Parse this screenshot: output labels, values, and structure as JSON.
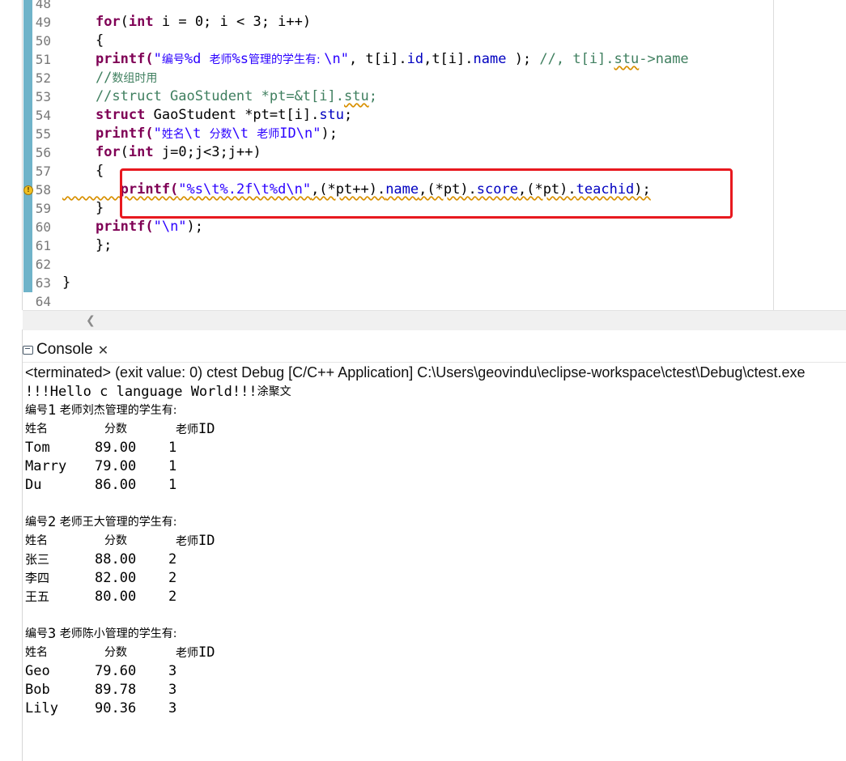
{
  "editor": {
    "lines": [
      {
        "num": "48",
        "segs": []
      },
      {
        "num": "49",
        "segs": [
          {
            "t": "    "
          },
          {
            "t": "for",
            "c": "kw"
          },
          {
            "t": "("
          },
          {
            "t": "int",
            "c": "kw"
          },
          {
            "t": " i = 0; i < 3; i++)"
          }
        ]
      },
      {
        "num": "50",
        "segs": [
          {
            "t": "    {"
          }
        ]
      },
      {
        "num": "51",
        "segs": [
          {
            "t": "    printf(",
            "c": "kw"
          },
          {
            "t": "\"",
            "c": "str"
          },
          {
            "t": "编号",
            "c": "str cjk"
          },
          {
            "t": "%d ",
            "c": "str"
          },
          {
            "t": "老师",
            "c": "str cjk"
          },
          {
            "t": "%s",
            "c": "str"
          },
          {
            "t": "管理的学生有: ",
            "c": "str cjk"
          },
          {
            "t": "\\n\"",
            "c": "str"
          },
          {
            "t": ", t[i]."
          },
          {
            "t": "id",
            "c": "fld"
          },
          {
            "t": ",t[i]."
          },
          {
            "t": "name",
            "c": "fld"
          },
          {
            "t": " ); "
          },
          {
            "t": "//, t[i].",
            "c": "cmt"
          },
          {
            "t": "stu",
            "c": "cmt sq"
          },
          {
            "t": "->name",
            "c": "cmt"
          }
        ]
      },
      {
        "num": "52",
        "segs": [
          {
            "t": "    //",
            "c": "cmt"
          },
          {
            "t": "数组时用",
            "c": "cmt cjk"
          }
        ]
      },
      {
        "num": "53",
        "segs": [
          {
            "t": "    //struct GaoStudent *pt=&t[i].",
            "c": "cmt"
          },
          {
            "t": "stu",
            "c": "cmt sq"
          },
          {
            "t": ";",
            "c": "cmt"
          }
        ]
      },
      {
        "num": "54",
        "segs": [
          {
            "t": "    "
          },
          {
            "t": "struct",
            "c": "kw"
          },
          {
            "t": " GaoStudent *pt=t[i]."
          },
          {
            "t": "stu",
            "c": "fld"
          },
          {
            "t": ";"
          }
        ]
      },
      {
        "num": "55",
        "segs": [
          {
            "t": "    printf(",
            "c": "kw"
          },
          {
            "t": "\"",
            "c": "str"
          },
          {
            "t": "姓名",
            "c": "str cjk"
          },
          {
            "t": "\\t ",
            "c": "str"
          },
          {
            "t": "分数",
            "c": "str cjk"
          },
          {
            "t": "\\t ",
            "c": "str"
          },
          {
            "t": "老师",
            "c": "str cjk"
          },
          {
            "t": "ID\\n\"",
            "c": "str"
          },
          {
            "t": ");"
          }
        ]
      },
      {
        "num": "56",
        "segs": [
          {
            "t": "    "
          },
          {
            "t": "for",
            "c": "kw"
          },
          {
            "t": "("
          },
          {
            "t": "int",
            "c": "kw"
          },
          {
            "t": " j=0;j<3;j++)"
          }
        ]
      },
      {
        "num": "57",
        "segs": [
          {
            "t": "    {"
          }
        ]
      },
      {
        "num": "58",
        "warn": true,
        "segs": [
          {
            "t": "       printf(",
            "c": "kw sq"
          },
          {
            "t": "\"%s\\t%.2f\\t%d\\n\"",
            "c": "str sq"
          },
          {
            "t": ",(*pt++).",
            "c": "sq"
          },
          {
            "t": "name",
            "c": "fld sq"
          },
          {
            "t": ",(*pt).",
            "c": "sq"
          },
          {
            "t": "score",
            "c": "fld sq"
          },
          {
            "t": ",(*pt).",
            "c": "sq"
          },
          {
            "t": "teachid",
            "c": "fld sq"
          },
          {
            "t": ");",
            "c": "sq"
          }
        ]
      },
      {
        "num": "59",
        "segs": [
          {
            "t": "    }"
          }
        ]
      },
      {
        "num": "60",
        "segs": [
          {
            "t": "    printf(",
            "c": "kw"
          },
          {
            "t": "\"\\n\"",
            "c": "str"
          },
          {
            "t": ");"
          }
        ]
      },
      {
        "num": "61",
        "segs": [
          {
            "t": "    };"
          }
        ]
      },
      {
        "num": "62",
        "segs": []
      },
      {
        "num": "63",
        "segs": [
          {
            "t": "}"
          }
        ]
      },
      {
        "num": "64",
        "segs": []
      }
    ],
    "highlight_color": "#e8191f"
  },
  "console": {
    "tab_label": "Console",
    "close_glyph": "✕",
    "status": "<terminated> (exit value: 0) ctest Debug [C/C++ Application] C:\\Users\\geovindu\\eclipse-workspace\\ctest\\Debug\\ctest.exe",
    "greeting_ascii": "!!!Hello c language World!!!",
    "greeting_cjk": "涂聚文",
    "header_cols": {
      "name": "姓名",
      "score": "分数",
      "tid_cjk": "老师",
      "tid_ascii": "ID"
    },
    "groups": [
      {
        "title_prefix": "编号",
        "num": "1",
        "title_rest": " 老师刘杰管理的学生有:",
        "rows": [
          {
            "name": "Tom",
            "score": "89.00",
            "tid": "1"
          },
          {
            "name": "Marry",
            "score": "79.00",
            "tid": "1"
          },
          {
            "name": "Du",
            "score": "86.00",
            "tid": "1"
          }
        ]
      },
      {
        "title_prefix": "编号",
        "num": "2",
        "title_rest": " 老师王大管理的学生有:",
        "rows": [
          {
            "name": "张三",
            "score": "88.00",
            "tid": "2",
            "cjk": true
          },
          {
            "name": "李四",
            "score": "82.00",
            "tid": "2",
            "cjk": true
          },
          {
            "name": "王五",
            "score": "80.00",
            "tid": "2",
            "cjk": true
          }
        ]
      },
      {
        "title_prefix": "编号",
        "num": "3",
        "title_rest": " 老师陈小管理的学生有:",
        "rows": [
          {
            "name": "Geo",
            "score": "79.60",
            "tid": "3"
          },
          {
            "name": "Bob",
            "score": "89.78",
            "tid": "3"
          },
          {
            "name": "Lily",
            "score": "90.36",
            "tid": "3"
          }
        ]
      }
    ]
  }
}
